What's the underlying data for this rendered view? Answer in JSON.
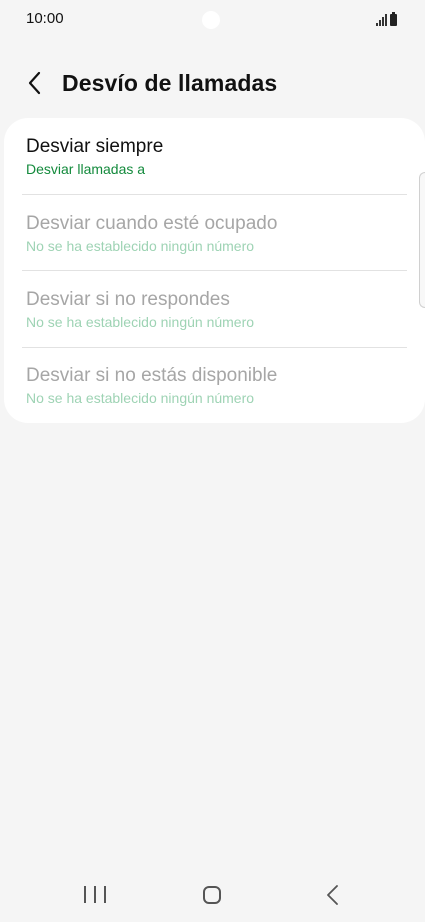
{
  "status_bar": {
    "time": "10:00",
    "signal_icon": "signal-bars-icon",
    "battery_icon": "battery-icon"
  },
  "header": {
    "title": "Desvío de llamadas",
    "back_icon": "chevron-left-icon"
  },
  "forwarding_options": [
    {
      "title": "Desviar siempre",
      "subtitle": "Desviar llamadas a",
      "enabled": true
    },
    {
      "title": "Desviar cuando esté ocupado",
      "subtitle": "No se ha establecido ningún número",
      "enabled": false
    },
    {
      "title": "Desviar si no respondes",
      "subtitle": "No se ha establecido ningún número",
      "enabled": false
    },
    {
      "title": "Desviar si no estás disponible",
      "subtitle": "No se ha establecido ningún número",
      "enabled": false
    }
  ],
  "nav_bar": {
    "recents_icon": "recents-icon",
    "home_icon": "home-icon",
    "back_icon": "back-icon"
  },
  "colors": {
    "accent": "#138a3c",
    "accent_disabled": "#9ed3b4",
    "background": "#f5f5f5",
    "card": "#ffffff"
  }
}
